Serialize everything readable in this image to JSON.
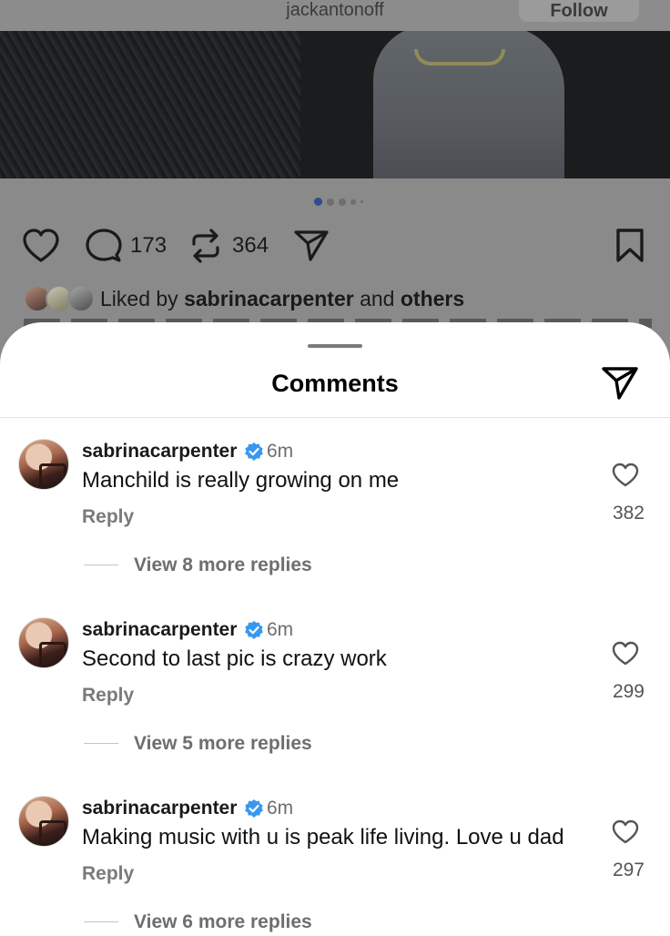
{
  "post": {
    "username": "jackantonoff",
    "follow_label": "Follow",
    "comment_count": "173",
    "repost_count": "364",
    "liked_by_prefix": "Liked by ",
    "liked_by_user": "sabrinacarpenter",
    "liked_by_and": " and ",
    "liked_by_others": "others",
    "carousel": {
      "total": 5,
      "active_index": 0
    }
  },
  "sheet": {
    "title": "Comments"
  },
  "comments": [
    {
      "user": "sabrinacarpenter",
      "time": "6m",
      "text": "Manchild is really growing on me",
      "reply_label": "Reply",
      "likes": "382",
      "view_replies": "View 8 more replies"
    },
    {
      "user": "sabrinacarpenter",
      "time": "6m",
      "text": "Second to last pic is crazy work",
      "reply_label": "Reply",
      "likes": "299",
      "view_replies": "View 5 more replies"
    },
    {
      "user": "sabrinacarpenter",
      "time": "6m",
      "text": "Making music with u is peak life living. Love u dad",
      "reply_label": "Reply",
      "likes": "297",
      "view_replies": "View 6 more replies"
    }
  ],
  "colors": {
    "verified": "#3897f0",
    "active_dot": "#2d4f8a",
    "sheet_bg": "#ffffff",
    "dim_overlay": "#8a8a8a"
  },
  "icons": {
    "back": "back-icon",
    "like": "heart-icon",
    "comment": "comment-icon",
    "repost": "repost-icon",
    "share": "paper-plane-icon",
    "bookmark": "bookmark-icon",
    "verified": "verified-badge-icon"
  }
}
